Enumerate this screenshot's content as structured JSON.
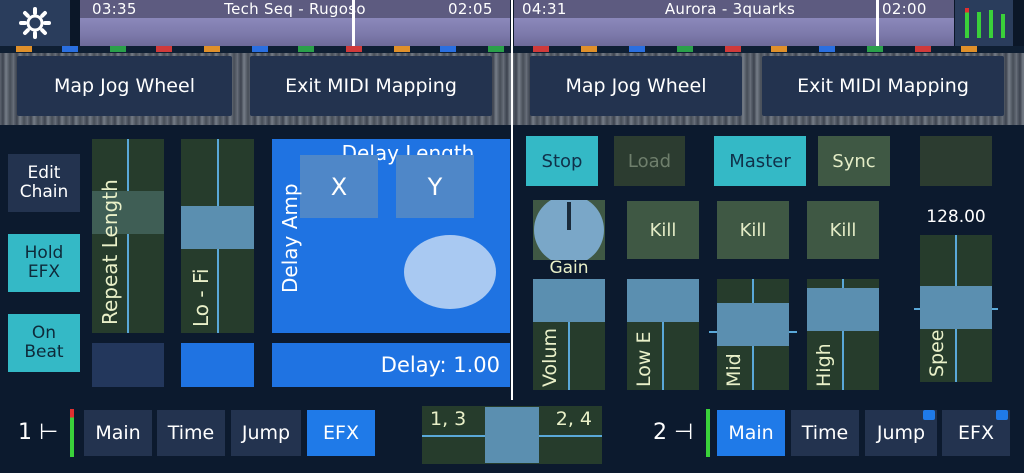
{
  "deck_left": {
    "time_elapsed": "03:35",
    "track_title": "Tech Seq - Rugoso",
    "time_remaining": "02:05",
    "map_jog_label": "Map Jog Wheel",
    "exit_midi_label": "Exit MIDI Mapping",
    "side_buttons": [
      {
        "label_line1": "Edit",
        "label_line2": "Chain"
      },
      {
        "label_line1": "Hold",
        "label_line2": "EFX"
      },
      {
        "label_line1": "On",
        "label_line2": "Beat"
      }
    ],
    "repeat_length_label": "Repeat Length",
    "lofi_label": "Lo - Fi",
    "xy_pad": {
      "title": "Delay Length",
      "x_label": "X",
      "y_label": "Y",
      "y_axis_label": "Delay Amp"
    },
    "delay_status": "Delay: 1.00",
    "deck_number": "1",
    "tabs": [
      "Main",
      "Time",
      "Jump",
      "EFX"
    ],
    "active_tab": "EFX"
  },
  "deck_right": {
    "time_elapsed": "04:31",
    "track_title": "Aurora - 3quarks",
    "time_remaining": "02:00",
    "map_jog_label": "Map Jog Wheel",
    "exit_midi_label": "Exit MIDI Mapping",
    "stop_label": "Stop",
    "load_label": "Load",
    "master_label": "Master",
    "sync_label": "Sync",
    "kill_labels": [
      "Kill",
      "Kill",
      "Kill"
    ],
    "gain_label": "Gain",
    "bpm": "128.00",
    "eq_labels": [
      "Volum",
      "Low E",
      "Mid",
      "High",
      "Spee"
    ],
    "deck_number": "2",
    "tabs": [
      "Main",
      "Time",
      "Jump",
      "EFX"
    ],
    "active_tab": "Main"
  },
  "crossfader": {
    "left_label": "1, 3",
    "right_label": "2, 4"
  },
  "colors": {
    "accent_blue": "#1f7ae8",
    "teal": "#34b9c6",
    "olive": "#3f5844",
    "navy": "#23334f"
  }
}
